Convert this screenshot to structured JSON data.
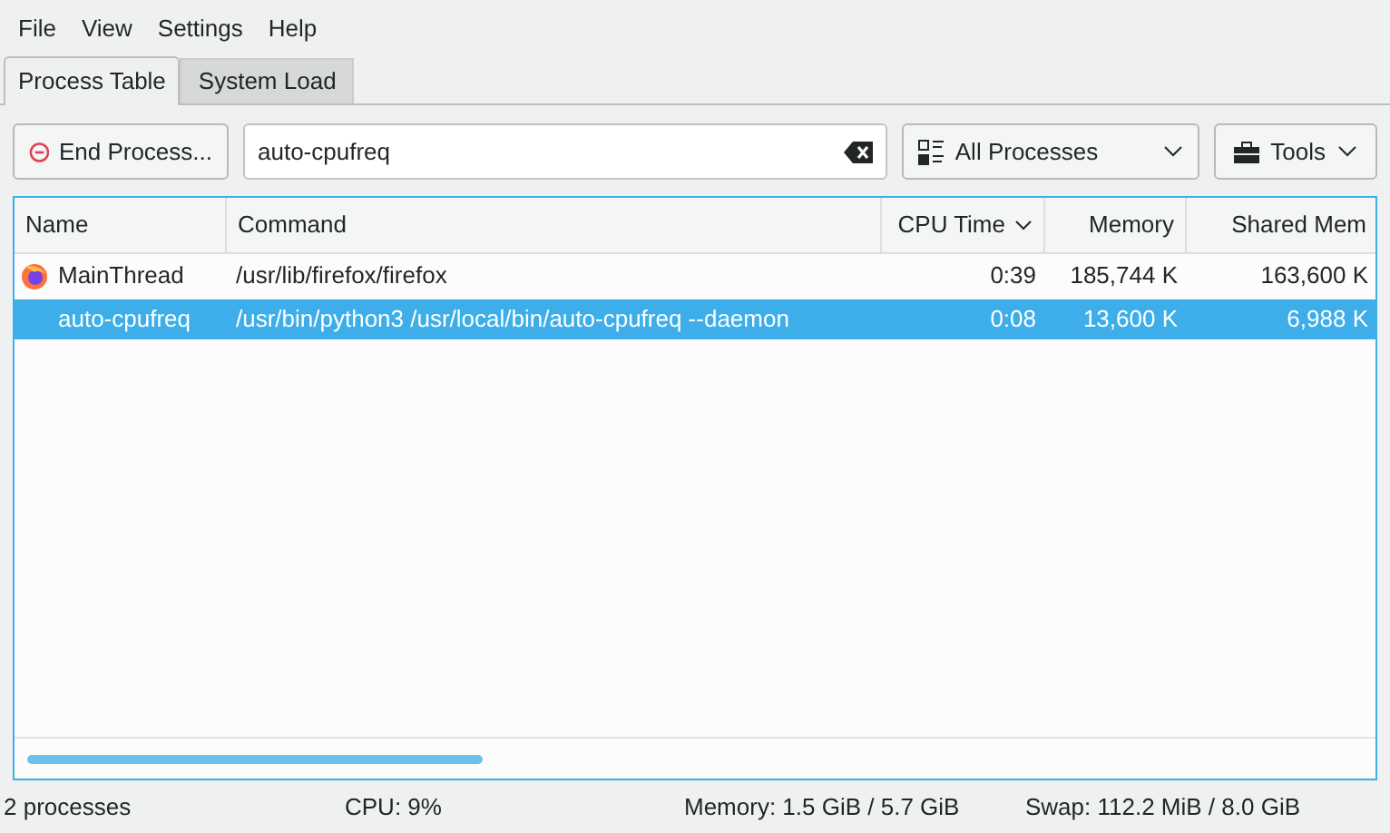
{
  "menu": [
    "File",
    "View",
    "Settings",
    "Help"
  ],
  "tabs": [
    {
      "label": "Process Table",
      "selected": true
    },
    {
      "label": "System Load",
      "selected": false
    }
  ],
  "toolbar": {
    "end_process": "End Process...",
    "search": {
      "value": "auto-cpufreq"
    },
    "filter": "All Processes",
    "tools": "Tools"
  },
  "table": {
    "columns": [
      {
        "label": "Name",
        "sorted": false
      },
      {
        "label": "Command",
        "sorted": false
      },
      {
        "label": "CPU Time",
        "sorted": true
      },
      {
        "label": "Memory",
        "sorted": false
      },
      {
        "label": "Shared Mem",
        "sorted": false
      }
    ],
    "rows": [
      {
        "has_icon": true,
        "selected": false,
        "cells": [
          "MainThread",
          "/usr/lib/firefox/firefox",
          "0:39",
          "185,744 K",
          "163,600 K"
        ]
      },
      {
        "has_icon": false,
        "selected": true,
        "cells": [
          "auto-cpufreq",
          "/usr/bin/python3 /usr/local/bin/auto-cpufreq --daemon",
          "0:08",
          "13,600 K",
          "6,988 K"
        ]
      }
    ]
  },
  "status_bar": [
    "2 processes",
    "CPU: 9%",
    "Memory: 1.5 GiB / 5.7 GiB",
    "Swap: 112.2 MiB / 8.0 GiB"
  ]
}
